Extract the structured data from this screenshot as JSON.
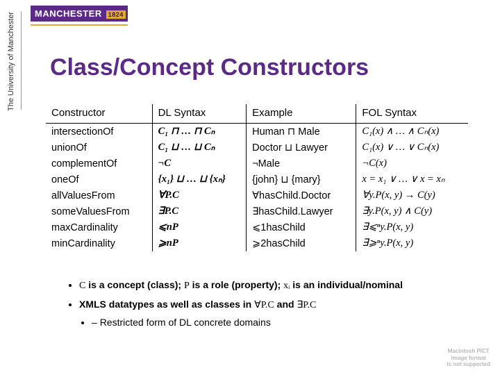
{
  "logo": {
    "name": "MANCHESTER",
    "year": "1824",
    "sidebar": "The University of Manchester"
  },
  "title": "Class/Concept Constructors",
  "table": {
    "headers": [
      "Constructor",
      "DL Syntax",
      "Example",
      "FOL Syntax"
    ],
    "rows": [
      {
        "c": "intersectionOf",
        "dl": "C₁ ⊓ … ⊓ Cₙ",
        "ex": "Human ⊓ Male",
        "fol": "C₁(x) ∧ … ∧ Cₙ(x)"
      },
      {
        "c": "unionOf",
        "dl": "C₁ ⊔ … ⊔ Cₙ",
        "ex": "Doctor ⊔ Lawyer",
        "fol": "C₁(x) ∨ … ∨ Cₙ(x)"
      },
      {
        "c": "complementOf",
        "dl": "¬C",
        "ex": "¬Male",
        "fol": "¬C(x)"
      },
      {
        "c": "oneOf",
        "dl": "{x₁} ⊔ … ⊔ {xₙ}",
        "ex": "{john} ⊔ {mary}",
        "fol": "x = x₁ ∨ … ∨ x = xₙ"
      },
      {
        "c": "allValuesFrom",
        "dl": "∀P.C",
        "ex": "∀hasChild.Doctor",
        "fol": "∀y.P(x, y) → C(y)"
      },
      {
        "c": "someValuesFrom",
        "dl": "∃P.C",
        "ex": "∃hasChild.Lawyer",
        "fol": "∃y.P(x, y) ∧ C(y)"
      },
      {
        "c": "maxCardinality",
        "dl": "⩽nP",
        "ex": "⩽1hasChild",
        "fol": "∃⩽ⁿy.P(x, y)"
      },
      {
        "c": "minCardinality",
        "dl": "⩾nP",
        "ex": "⩾2hasChild",
        "fol": "∃⩾ⁿy.P(x, y)"
      }
    ]
  },
  "bullets": {
    "b1_pre": "C",
    "b1_a": " is a concept (class); ",
    "b1_p": "P",
    "b1_b": " is a role (property); ",
    "b1_x": "xᵢ",
    "b1_c": " is an individual/nominal",
    "b2_a": "XMLS datatypes as well as classes in ",
    "b2_m": "∀P.C",
    "b2_b": " and ",
    "b2_n": "∃P.C",
    "sub1": "Restricted form of DL concrete domains"
  },
  "footer": {
    "l1": "Macintosh PICT",
    "l2": "image format",
    "l3": "is not supported"
  }
}
